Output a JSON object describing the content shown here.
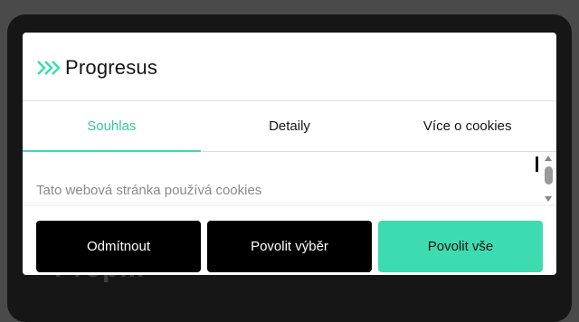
{
  "backdrop": {
    "text": "Prop..."
  },
  "header": {
    "logo_text": "Progresus",
    "logo_icon": "double-chevron-right-icon"
  },
  "tabs": [
    {
      "label": "Souhlas",
      "active": true
    },
    {
      "label": "Detaily",
      "active": false
    },
    {
      "label": "Více o cookies",
      "active": false
    }
  ],
  "content": {
    "heading": "Tato webová stránka používá cookies"
  },
  "buttons": {
    "reject": "Odmítnout",
    "allow_selection": "Povolit výběr",
    "allow_all": "Povolit vše"
  },
  "colors": {
    "accent": "#3ddcb0",
    "accent_text": "#33c9a0",
    "dark": "#000000"
  }
}
